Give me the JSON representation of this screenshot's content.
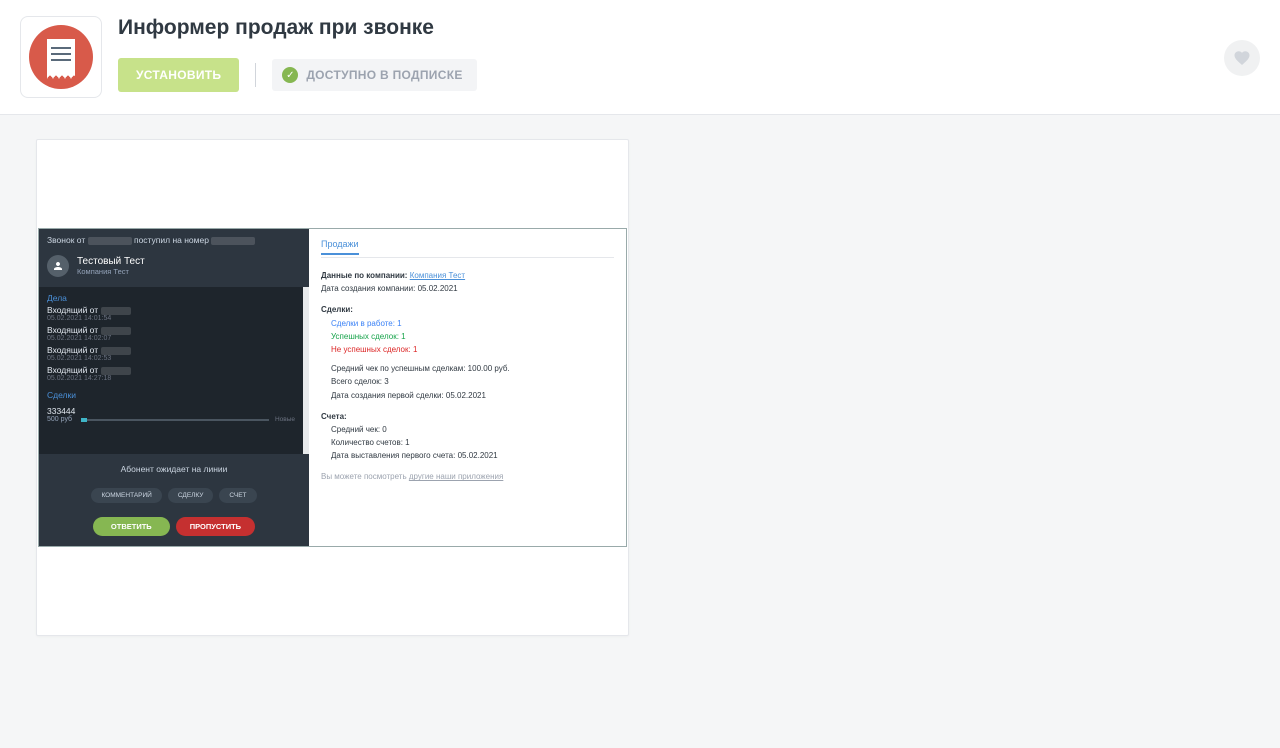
{
  "header": {
    "title": "Информер продаж при звонке",
    "install_label": "УСТАНОВИТЬ",
    "subscription_label": "ДОСТУПНО В ПОДПИСКЕ"
  },
  "call": {
    "top_prefix": "Звонок от",
    "top_mid": "поступил на номер",
    "caller_name": "Тестовый Тест",
    "caller_company": "Компания Тест",
    "section_deals_history": "Дела",
    "lines": [
      {
        "text": "Входящий от",
        "date": "05.02.2021 14:01:54"
      },
      {
        "text": "Входящий от",
        "date": "05.02.2021 14:02:07"
      },
      {
        "text": "Входящий от",
        "date": "05.02.2021 14:02:53"
      },
      {
        "text": "Входящий от",
        "date": "05.02.2021 14:27:18"
      }
    ],
    "section_deals": "Сделки",
    "deal_name": "333444",
    "deal_price": "500 руб",
    "deal_stage": "Новые",
    "wait": "Абонент ожидает на линии",
    "pills": {
      "comment": "КОММЕНТАРИЙ",
      "deal": "СДЕЛКУ",
      "invoice": "СЧЕТ"
    },
    "buttons": {
      "answer": "ОТВЕТИТЬ",
      "skip": "ПРОПУСТИТЬ"
    }
  },
  "sales": {
    "tab": "Продажи",
    "company_label": "Данные по компании:",
    "company_name": "Компания Тест",
    "company_created_label": "Дата создания компании:",
    "company_created_value": "05.02.2021",
    "deals_header": "Сделки:",
    "deals_in_progress": "Сделки в работе: 1",
    "deals_success": "Успешных сделок: 1",
    "deals_fail": "Не успешных сделок: 1",
    "avg_check_deals": "Средний чек по успешным сделкам: 100.00 руб.",
    "total_deals": "Всего сделок: 3",
    "first_deal_date": "Дата создания первой сделки: 05.02.2021",
    "invoices_header": "Счета:",
    "avg_check": "Средний чек: 0",
    "invoices_count": "Количество счетов: 1",
    "first_invoice_date": "Дата выставления первого счета: 05.02.2021",
    "footer_prefix": "Вы можете посмотреть",
    "footer_link": "другие наши приложения"
  }
}
